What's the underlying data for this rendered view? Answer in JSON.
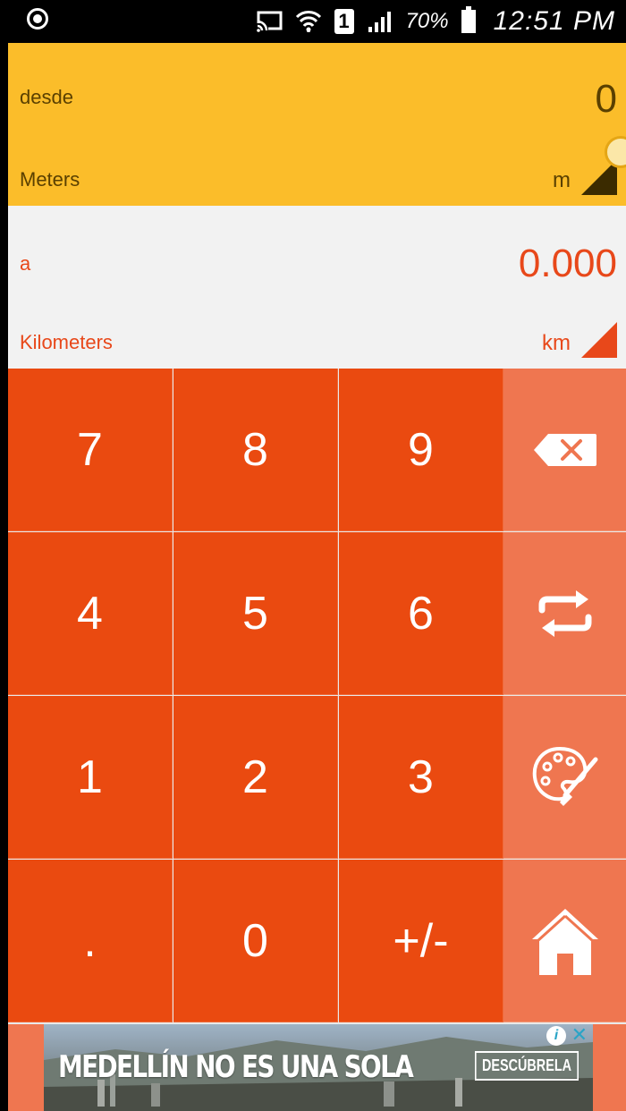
{
  "status_bar": {
    "battery": "70%",
    "sim_slot": "1",
    "time": "12:51 PM"
  },
  "converter": {
    "from": {
      "label": "desde",
      "value": "0",
      "unit_name": "Meters",
      "unit_abbr": "m"
    },
    "to": {
      "label": "a",
      "value": "0.000",
      "unit_name": "Kilometers",
      "unit_abbr": "km"
    }
  },
  "keypad": {
    "k7": "7",
    "k8": "8",
    "k9": "9",
    "k4": "4",
    "k5": "5",
    "k6": "6",
    "k1": "1",
    "k2": "2",
    "k3": "3",
    "kdot": ".",
    "k0": "0",
    "ksign": "+/-",
    "side_icons": [
      "backspace-icon",
      "swap-icon",
      "palette-icon",
      "home-icon"
    ]
  },
  "ad": {
    "headline": "MEDELLÍN NO ES UNA SOLA",
    "cta": "DESCÚBRELA",
    "info": "i",
    "close": "✕"
  },
  "colors": {
    "from_bg": "#fbbd2a",
    "to_bg": "#f2f2f2",
    "accent": "#e8481a",
    "key_bg": "#ea4a10",
    "side_key_bg": "#ef7650"
  }
}
